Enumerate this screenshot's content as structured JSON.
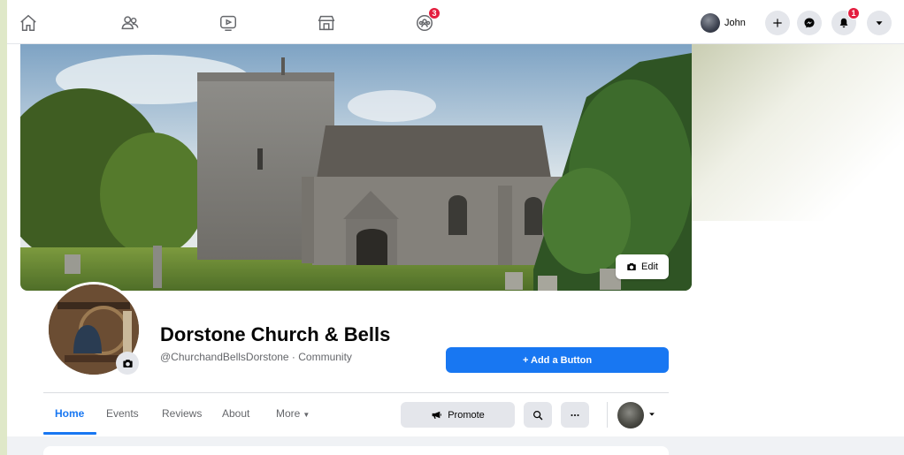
{
  "nav": {
    "notification_badges": {
      "groups": "3",
      "notifications": "1"
    },
    "user_name": "John",
    "icons": [
      "home-icon",
      "friends-icon",
      "watch-icon",
      "marketplace-icon",
      "groups-icon"
    ]
  },
  "cover": {
    "edit_label": "Edit"
  },
  "profile": {
    "name": "Dorstone Church & Bells",
    "handle": "@ChurchandBellsDorstone · Community",
    "add_button_label": "+ Add a Button"
  },
  "tabs": {
    "home": "Home",
    "events": "Events",
    "reviews": "Reviews",
    "about": "About",
    "more": "More"
  },
  "actions": {
    "promote_label": "Promote"
  },
  "colors": {
    "accent": "#1877f2",
    "badge": "#e41e3f",
    "button_gray": "#e4e6eb"
  }
}
